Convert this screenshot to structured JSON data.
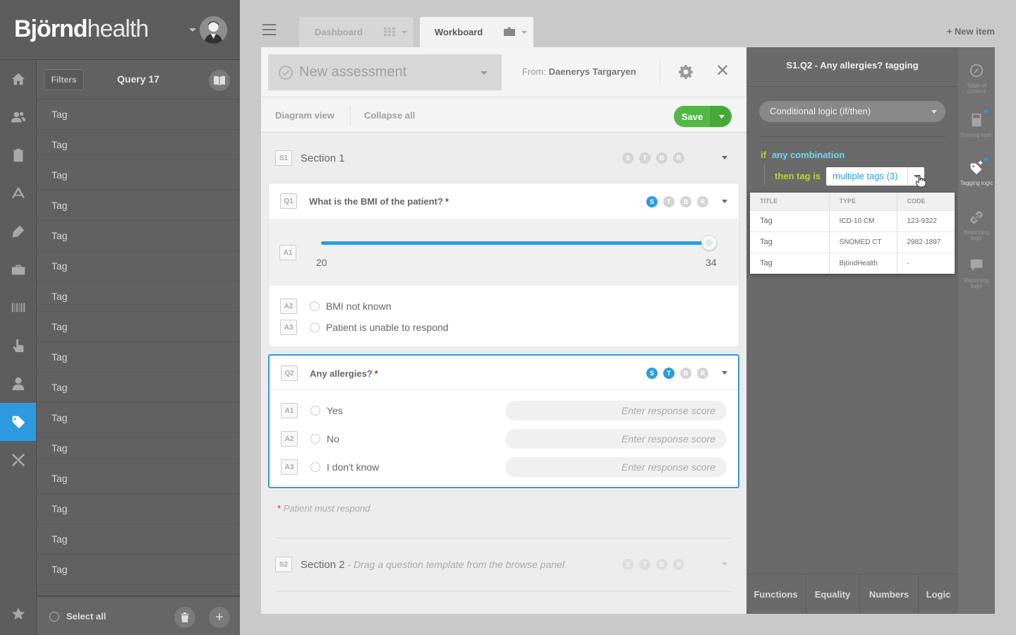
{
  "brand": {
    "name_bold": "Björnd",
    "name_light": "health"
  },
  "query_panel": {
    "filters_label": "Filters",
    "title": "Query 17",
    "items": [
      "Tag",
      "Tag",
      "Tag",
      "Tag",
      "Tag",
      "Tag",
      "Tag",
      "Tag",
      "Tag",
      "Tag",
      "Tag",
      "Tag",
      "Tag",
      "Tag",
      "Tag",
      "Tag"
    ],
    "select_all_label": "Select all",
    "add_symbol": "+"
  },
  "tabs": [
    {
      "label": "Dashboard",
      "active": false
    },
    {
      "label": "Workboard",
      "active": true
    }
  ],
  "new_item_label": "+ New item",
  "assessment": {
    "title": "New assessment",
    "from_label": "From:",
    "from_name": "Daenerys Targaryen",
    "close_symbol": "✕"
  },
  "toolbar": {
    "diagram_view": "Diagram view",
    "collapse_all": "Collapse all",
    "save_label": "Save"
  },
  "sections": [
    {
      "code": "S1",
      "name": "Section 1",
      "hint": ""
    },
    {
      "code": "S2",
      "name": "Section 2",
      "hint": "- Drag a question template from the browse panel"
    }
  ],
  "badge_letters": [
    "S",
    "T",
    "B",
    "R"
  ],
  "questions": [
    {
      "code": "Q1",
      "text": "What is the BMI of the patient?",
      "required": "*",
      "active_badges": [
        "S"
      ],
      "slider": {
        "code": "A1",
        "min": "20",
        "max": "34",
        "value_fraction": 1.0
      },
      "answers": [
        {
          "code": "A2",
          "label": "BMI not known"
        },
        {
          "code": "A3",
          "label": "Patient is unable to respond"
        }
      ]
    },
    {
      "code": "Q2",
      "text": "Any allergies?",
      "required": "*",
      "active_badges": [
        "S",
        "T"
      ],
      "score_placeholder": "Enter response score",
      "answers": [
        {
          "code": "A1",
          "label": "Yes"
        },
        {
          "code": "A2",
          "label": "No"
        },
        {
          "code": "A3",
          "label": "I don't know"
        }
      ]
    }
  ],
  "patient_must_respond": {
    "star": "*",
    "text": "Patient must respond"
  },
  "logic_panel": {
    "title": "S1.Q2 - Any allergies? tagging",
    "mode": "Conditional logic (if/then)",
    "if_keyword": "if",
    "if_value": "any combination",
    "then_keyword": "then tag is",
    "then_value": "multiple tags (3)",
    "table": {
      "headers": [
        "TITLE",
        "TYPE",
        "CODE"
      ],
      "rows": [
        [
          "Tag",
          "ICD-10 CM",
          "123-9322"
        ],
        [
          "Tag",
          "SNOMED CT",
          "2982-1897"
        ],
        [
          "Tag",
          "BjöndHealth",
          "-"
        ]
      ]
    },
    "footer_tabs": [
      "Functions",
      "Equality",
      "Numbers",
      "Logic"
    ]
  },
  "right_sidebar": [
    {
      "label": "Table of content",
      "icon": "compass-icon"
    },
    {
      "label": "Scoring logic",
      "icon": "calculator-icon"
    },
    {
      "label": "Tagging logic",
      "icon": "tag-icon"
    },
    {
      "label": "Branching logic",
      "icon": "link-icon"
    },
    {
      "label": "Reporting logic",
      "icon": "comment-icon"
    }
  ],
  "colors": {
    "accent": "#2e9be0",
    "save_green": "#52b746",
    "logic_if": "#b7d431",
    "logic_value": "#67d8f6",
    "required": "#d9262c"
  }
}
